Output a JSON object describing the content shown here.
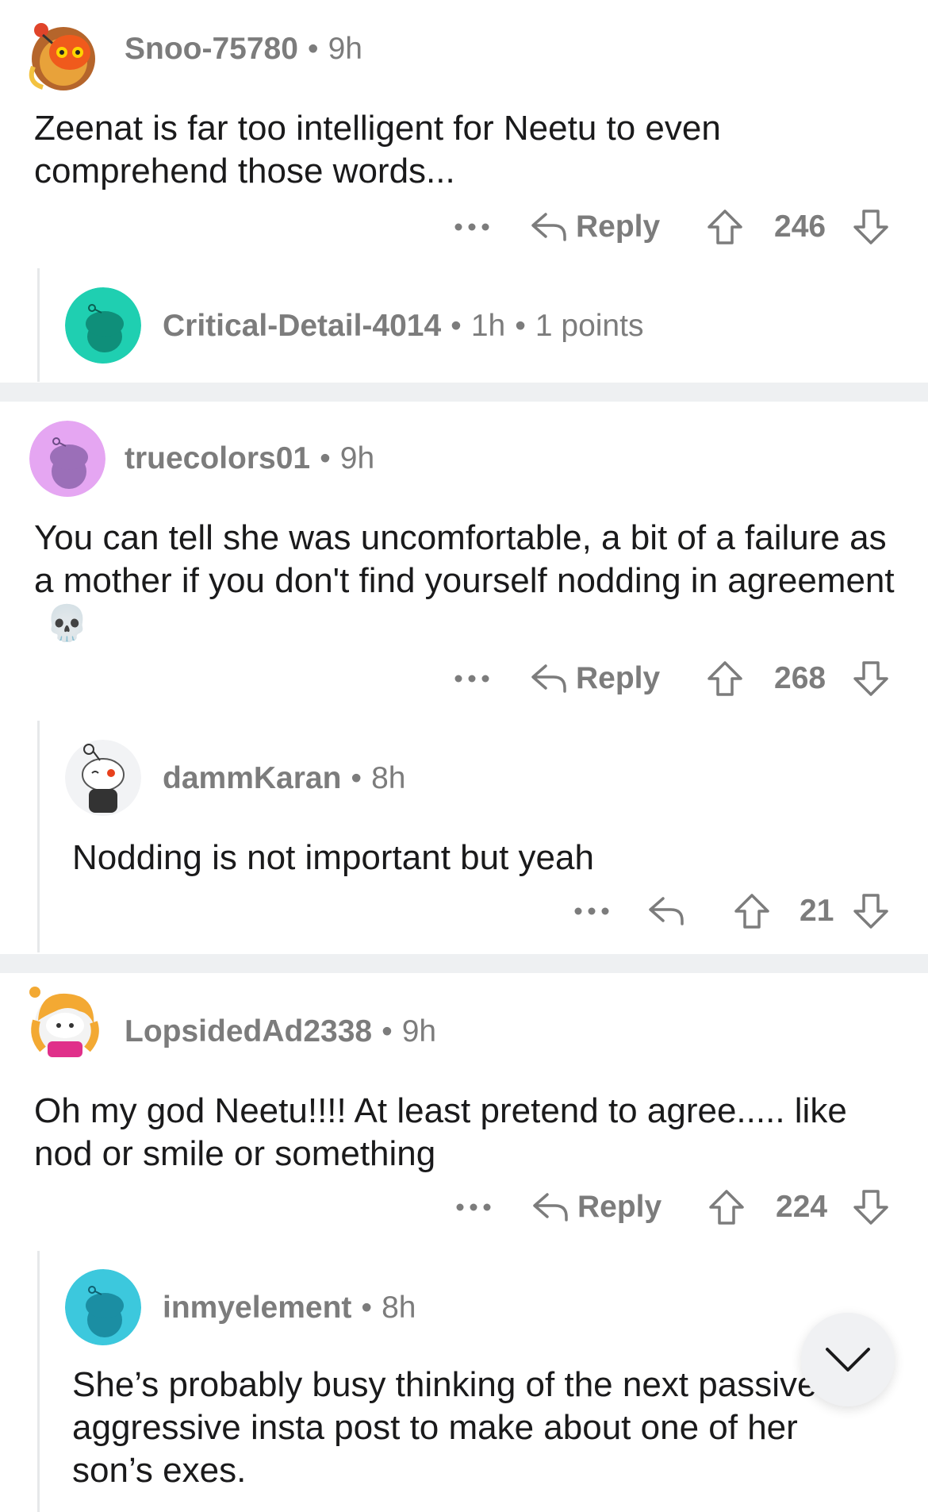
{
  "comments": [
    {
      "user": "Snoo-75780",
      "age": "9h",
      "text": "Zeenat is far too intelligent for Neetu to even comprehend those words...",
      "reply_label": "Reply",
      "score": "246",
      "replies": [
        {
          "user": "Critical-Detail-4014",
          "age": "1h",
          "points": "1 points"
        }
      ]
    },
    {
      "user": "truecolors01",
      "age": "9h",
      "text": "You can tell she was uncomfortable, a bit of a failure as a mother if you don't find yourself nodding in agreement",
      "emoji": "💀",
      "reply_label": "Reply",
      "score": "268",
      "replies": [
        {
          "user": "dammKaran",
          "age": "8h",
          "text": "Nodding is not important but yeah",
          "score": "21"
        }
      ]
    },
    {
      "user": "LopsidedAd2338",
      "age": "9h",
      "text": "Oh my god Neetu!!!! At least pretend to agree..... like nod or smile or something",
      "reply_label": "Reply",
      "score": "224",
      "replies": [
        {
          "user": "inmyelement",
          "age": "8h",
          "text": "She’s probably busy thinking of the next passive aggressive insta post to make about one of her son’s exes."
        }
      ]
    }
  ],
  "colors": {
    "text": "#1a1a1b",
    "meta": "#7c7c7c",
    "separator": "#eef0f2",
    "thread_line": "#e6e8ea"
  },
  "icons": [
    "more-icon",
    "reply-arrow-icon",
    "upvote-icon",
    "downvote-icon",
    "chevron-down-icon"
  ]
}
